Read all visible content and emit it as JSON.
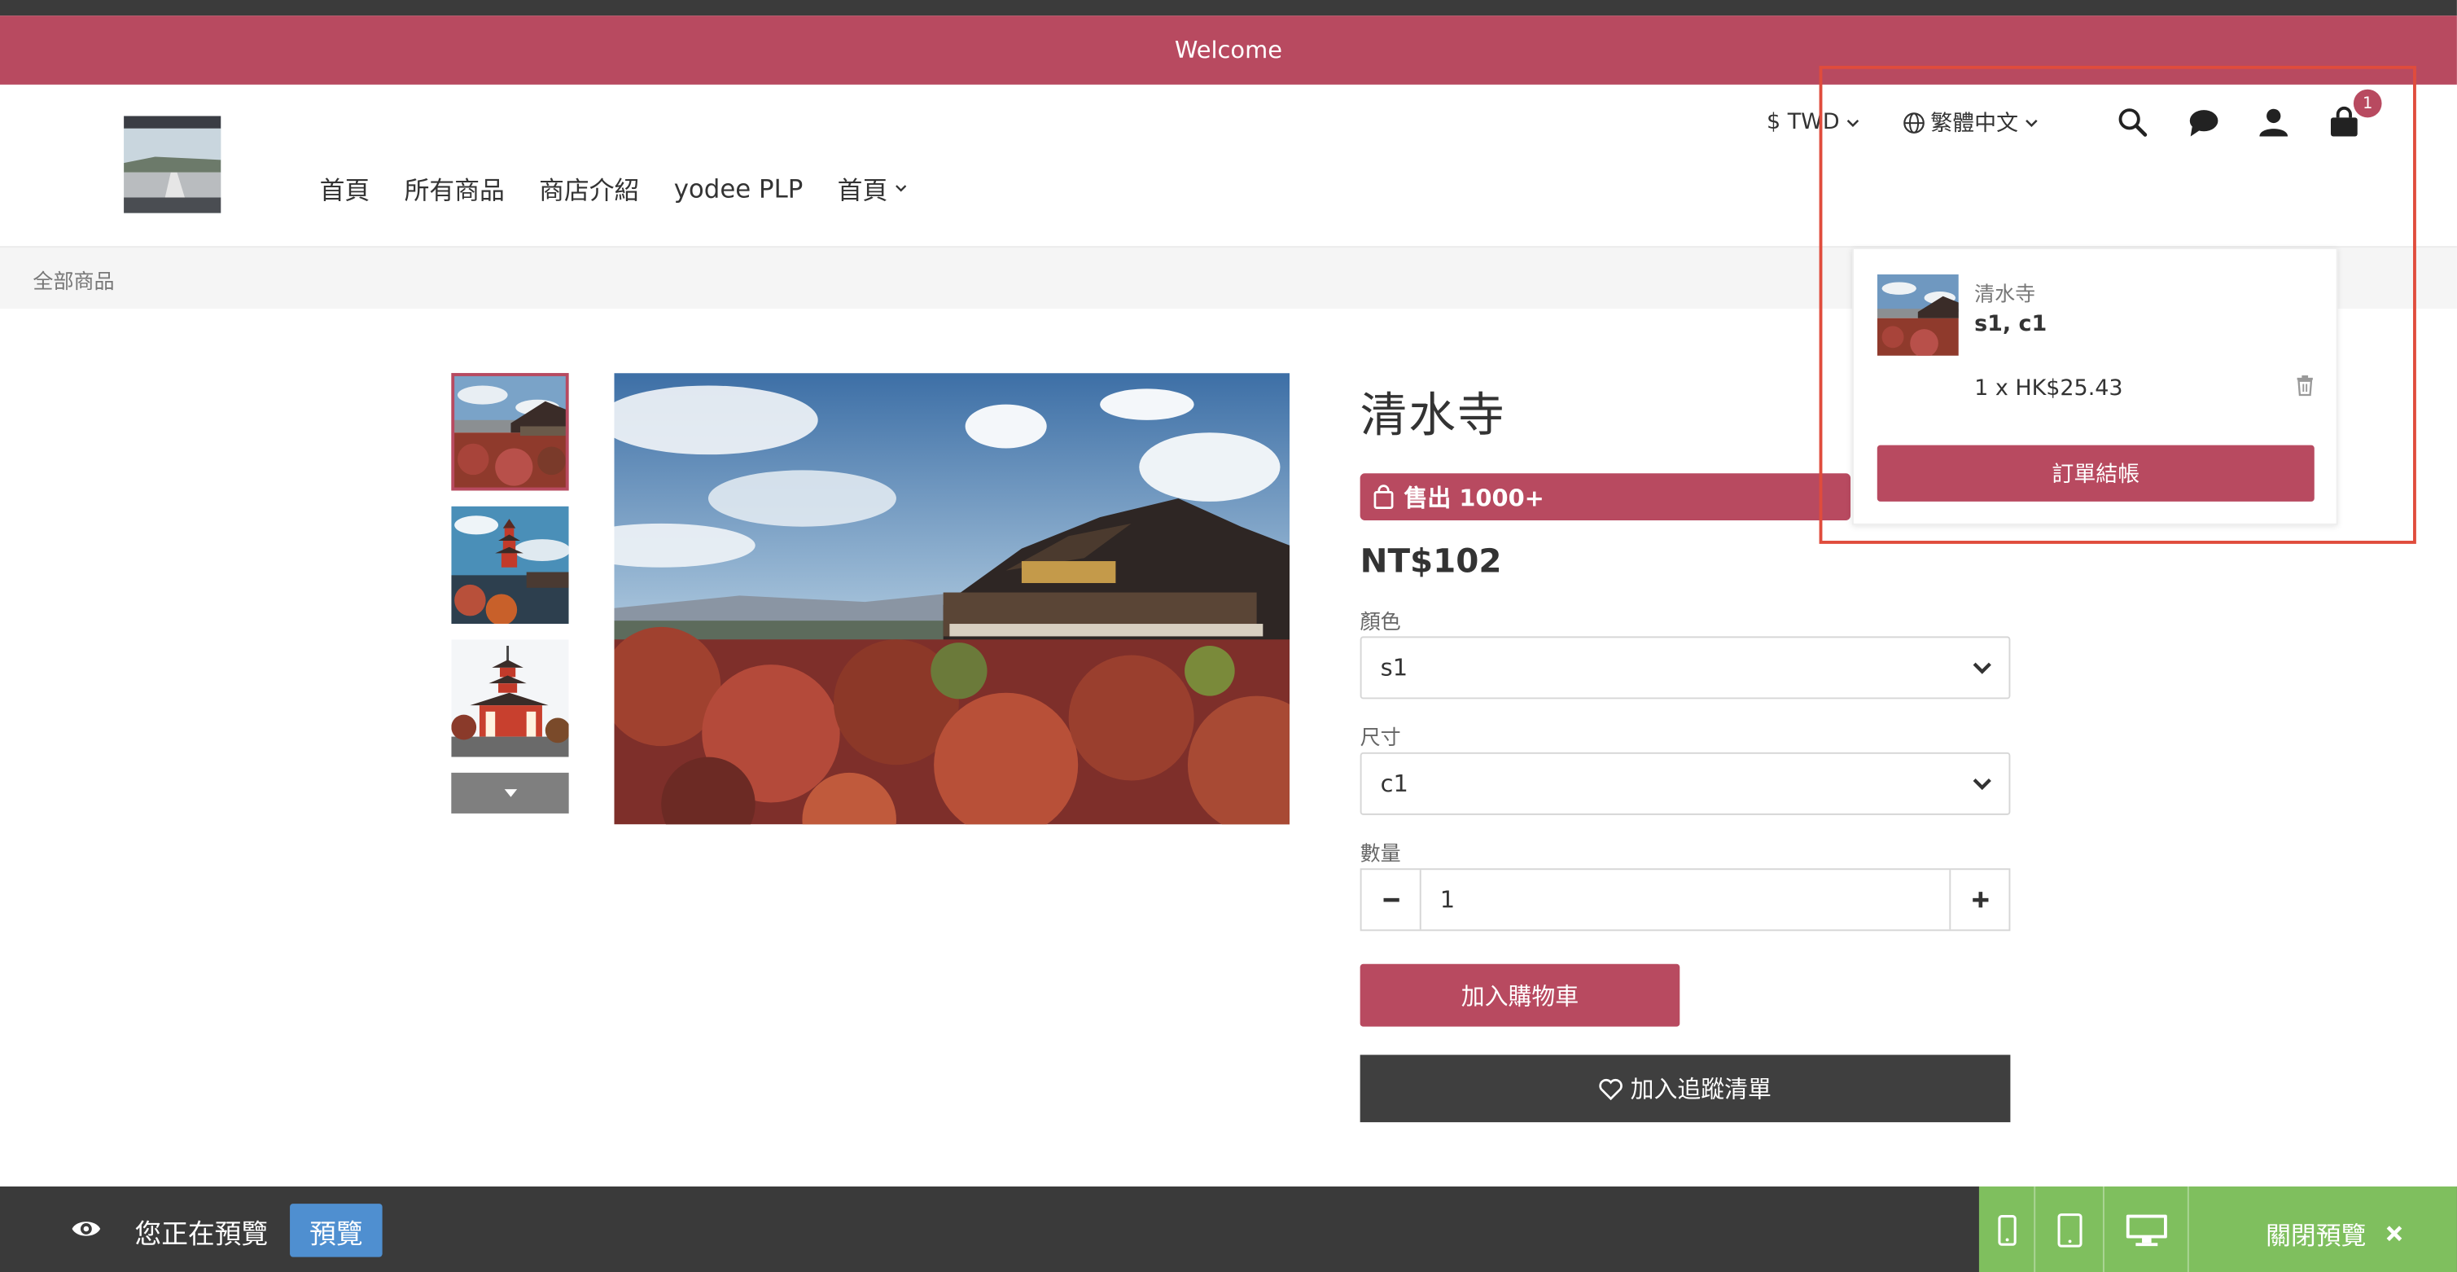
{
  "welcome": "Welcome",
  "header": {
    "nav": [
      "首頁",
      "所有商品",
      "商店介紹",
      "yodee PLP",
      "首頁"
    ],
    "currency": "$ TWD",
    "language": "繁體中文",
    "cart_count": "1"
  },
  "breadcrumb": "全部商品",
  "product": {
    "title": "清水寺",
    "sold_badge": "售出 1000+",
    "price": "NT$102",
    "color_label": "顏色",
    "color_value": "s1",
    "size_label": "尺寸",
    "size_value": "c1",
    "qty_label": "數量",
    "qty_value": "1",
    "add_to_cart": "加入購物車",
    "wishlist": "加入追蹤清單"
  },
  "cart_dropdown": {
    "item_name": "清水寺",
    "item_variant": "s1, c1",
    "item_qty_price": "1 x  HK$25.43",
    "checkout": "訂單結帳"
  },
  "preview_bar": {
    "text": "您正在預覽",
    "badge": "預覽",
    "close": "關閉預覽"
  },
  "colors": {
    "brand": "#b84a60",
    "dark": "#3f3f3f",
    "preview_green": "#7fbf5e",
    "preview_blue": "#4f8fd0",
    "highlight": "#e04c3c"
  }
}
